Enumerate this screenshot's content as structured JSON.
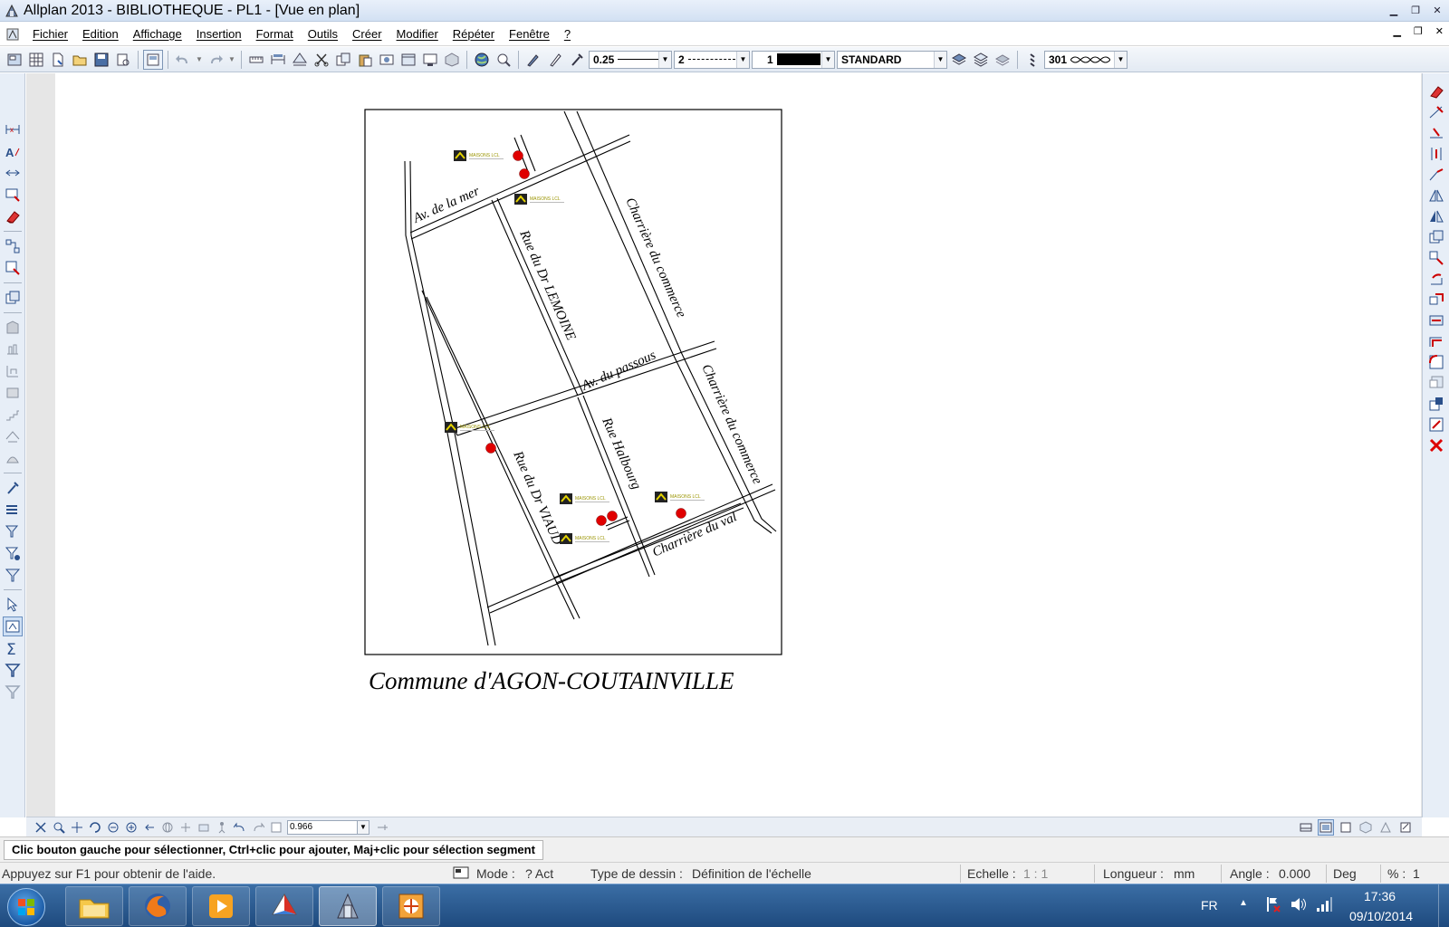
{
  "window": {
    "title": "Allplan 2013 - BIBLIOTHEQUE - PL1 - [Vue en plan]",
    "controls": [
      "minimize",
      "restore",
      "close"
    ]
  },
  "menu": {
    "items": [
      "Fichier",
      "Edition",
      "Affichage",
      "Insertion",
      "Format",
      "Outils",
      "Créer",
      "Modifier",
      "Répéter",
      "Fenêtre",
      "?"
    ]
  },
  "toolbar": {
    "pen_thickness": "0.25",
    "line_type": "2",
    "color_index": "1",
    "layer": "STANDARD",
    "hatch_pattern": "301"
  },
  "drawing": {
    "caption": "Commune d'AGON-COUTAINVILLE",
    "streets": [
      "Av. de la mer",
      "Rue du Dr LEMOINE",
      "Charrière du commerce",
      "Av. du passous",
      "Charrière du commerce",
      "Rue Halbourg",
      "Rue du Dr VIAUD",
      "Charrière du val"
    ],
    "logo_text": "MAISONS LCL",
    "marker_color": "#e00000"
  },
  "viewbar": {
    "zoom_value": "0.966"
  },
  "prompt": {
    "text": "Clic bouton gauche pour sélectionner, Ctrl+clic pour ajouter, Maj+clic pour sélection segment"
  },
  "status": {
    "help": "Appuyez sur F1 pour obtenir de l'aide.",
    "mode_label": "Mode :",
    "mode_value": "? Act",
    "drawing_type_label": "Type de dessin :",
    "drawing_type_value": "Définition de l'échelle",
    "scale_label": "Echelle :",
    "scale_value": "1 : 1",
    "length_label": "Longueur :",
    "length_unit": "mm",
    "angle_label": "Angle :",
    "angle_value": "0.000",
    "angle_unit": "Deg",
    "percent_label": "% :",
    "percent_value": "1"
  },
  "taskbar": {
    "language": "FR",
    "time": "17:36",
    "date": "09/10/2014"
  }
}
